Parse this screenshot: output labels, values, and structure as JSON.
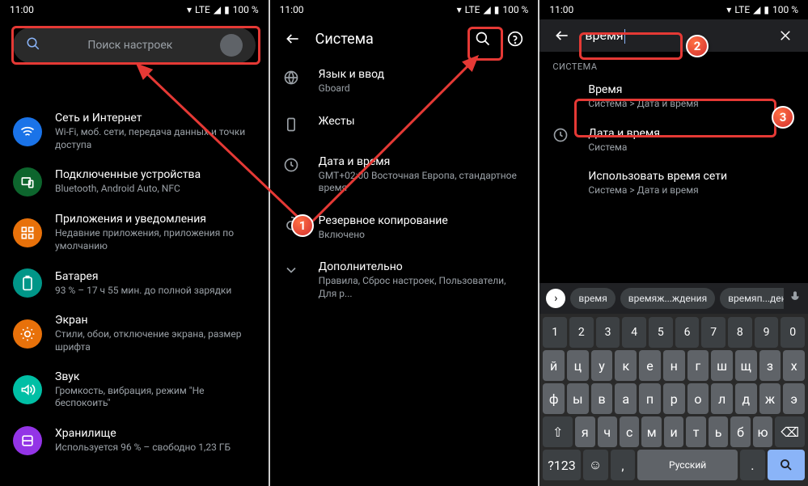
{
  "status": {
    "time": "11:00",
    "lte": "LTE",
    "battery": "100 %"
  },
  "pane1": {
    "search_placeholder": "Поиск настроек",
    "items": [
      {
        "title": "Сеть и Интернет",
        "sub": "Wi-Fi, моб. сети, передача данных и точки доступа",
        "bg": "#1a73e8",
        "glyph": "wifi"
      },
      {
        "title": "Подключенные устройства",
        "sub": "Bluetooth, Android Auto, NFC",
        "bg": "#0d652d",
        "glyph": "devices"
      },
      {
        "title": "Приложения и уведомления",
        "sub": "Недавние приложения, приложения по умолчанию",
        "bg": "#e8710a",
        "glyph": "apps"
      },
      {
        "title": "Батарея",
        "sub": "93 % – 17 ч 55 мин. до полной зарядки",
        "bg": "#009688",
        "glyph": "battery"
      },
      {
        "title": "Экран",
        "sub": "Стили, обои, отключение экрана, размер шрифта",
        "bg": "#e8710a",
        "glyph": "display"
      },
      {
        "title": "Звук",
        "sub": "Громкость, вибрация, режим \"Не беспокоить\"",
        "bg": "#00bfa5",
        "glyph": "sound"
      },
      {
        "title": "Хранилище",
        "sub": "Используется 96 % – свободно 1,23 ГБ",
        "bg": "#9334e6",
        "glyph": "storage"
      }
    ]
  },
  "pane2": {
    "title": "Система",
    "items": [
      {
        "title": "Язык и ввод",
        "sub": "Gboard",
        "glyph": "lang"
      },
      {
        "title": "Жесты",
        "sub": "",
        "glyph": "gesture"
      },
      {
        "title": "Дата и время",
        "sub": "GMT+02:00 Восточная Европа, стандартное время",
        "glyph": "clock"
      },
      {
        "title": "Резервное копирование",
        "sub": "Включено",
        "glyph": "backup"
      },
      {
        "title": "Дополнительно",
        "sub": "Правила, Сброс настроек, Пользователи, Для р...",
        "glyph": "expand"
      }
    ]
  },
  "pane3": {
    "query": "время",
    "section": "СИСТЕМА",
    "results": [
      {
        "title": "Время",
        "sub": "Система > Дата и время"
      },
      {
        "title": "Дата и время",
        "sub": "Система",
        "icon": true
      },
      {
        "title": "Использовать время сети",
        "sub": "Система > Дата и время"
      }
    ],
    "suggestions": [
      "время",
      "времяж...ждения",
      "времяп...дения"
    ],
    "keyboard": {
      "nums": [
        "1",
        "2",
        "3",
        "4",
        "5",
        "6",
        "7",
        "8",
        "9",
        "0"
      ],
      "row1": [
        "й",
        "ц",
        "у",
        "к",
        "е",
        "н",
        "г",
        "ш",
        "щ",
        "з",
        "х"
      ],
      "row2": [
        "ф",
        "ы",
        "в",
        "а",
        "п",
        "р",
        "о",
        "л",
        "д",
        "ж",
        "э"
      ],
      "row3": [
        "я",
        "ч",
        "с",
        "м",
        "и",
        "т",
        "ь",
        "б",
        "ю"
      ],
      "lang": "Русский",
      "sym": "?123"
    }
  }
}
